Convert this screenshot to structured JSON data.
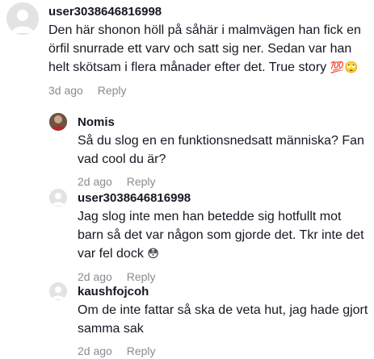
{
  "comments": [
    {
      "username": "user3038646816998",
      "text": "Den här shonon höll på såhär i malmvägen han fick en örfil snurrade ett varv och satt sig ner. Sedan var han helt skötsam i flera månader efter det. True story",
      "emojis": "💯🙄",
      "time": "3d ago",
      "reply_label": "Reply",
      "avatar": "default-avatar"
    },
    {
      "username": "Nomis",
      "text": "Så du slog en en funktionsnedsatt människa? Fan vad cool du är?",
      "emojis": "",
      "time": "2d ago",
      "reply_label": "Reply",
      "avatar": "photo-avatar"
    },
    {
      "username": "user3038646816998",
      "text": "Jag slog inte men han betedde sig hotfullt mot barn så det var någon som gjorde det. Tkr inte det var fel dock",
      "emojis": "😳",
      "time": "2d ago",
      "reply_label": "Reply",
      "avatar": "default-avatar"
    },
    {
      "username": "kaushfojcoh",
      "text": "Om de inte fattar så ska de veta hut, jag hade gjort samma sak",
      "emojis": "",
      "time": "2d ago",
      "reply_label": "Reply",
      "avatar": "default-avatar"
    }
  ]
}
